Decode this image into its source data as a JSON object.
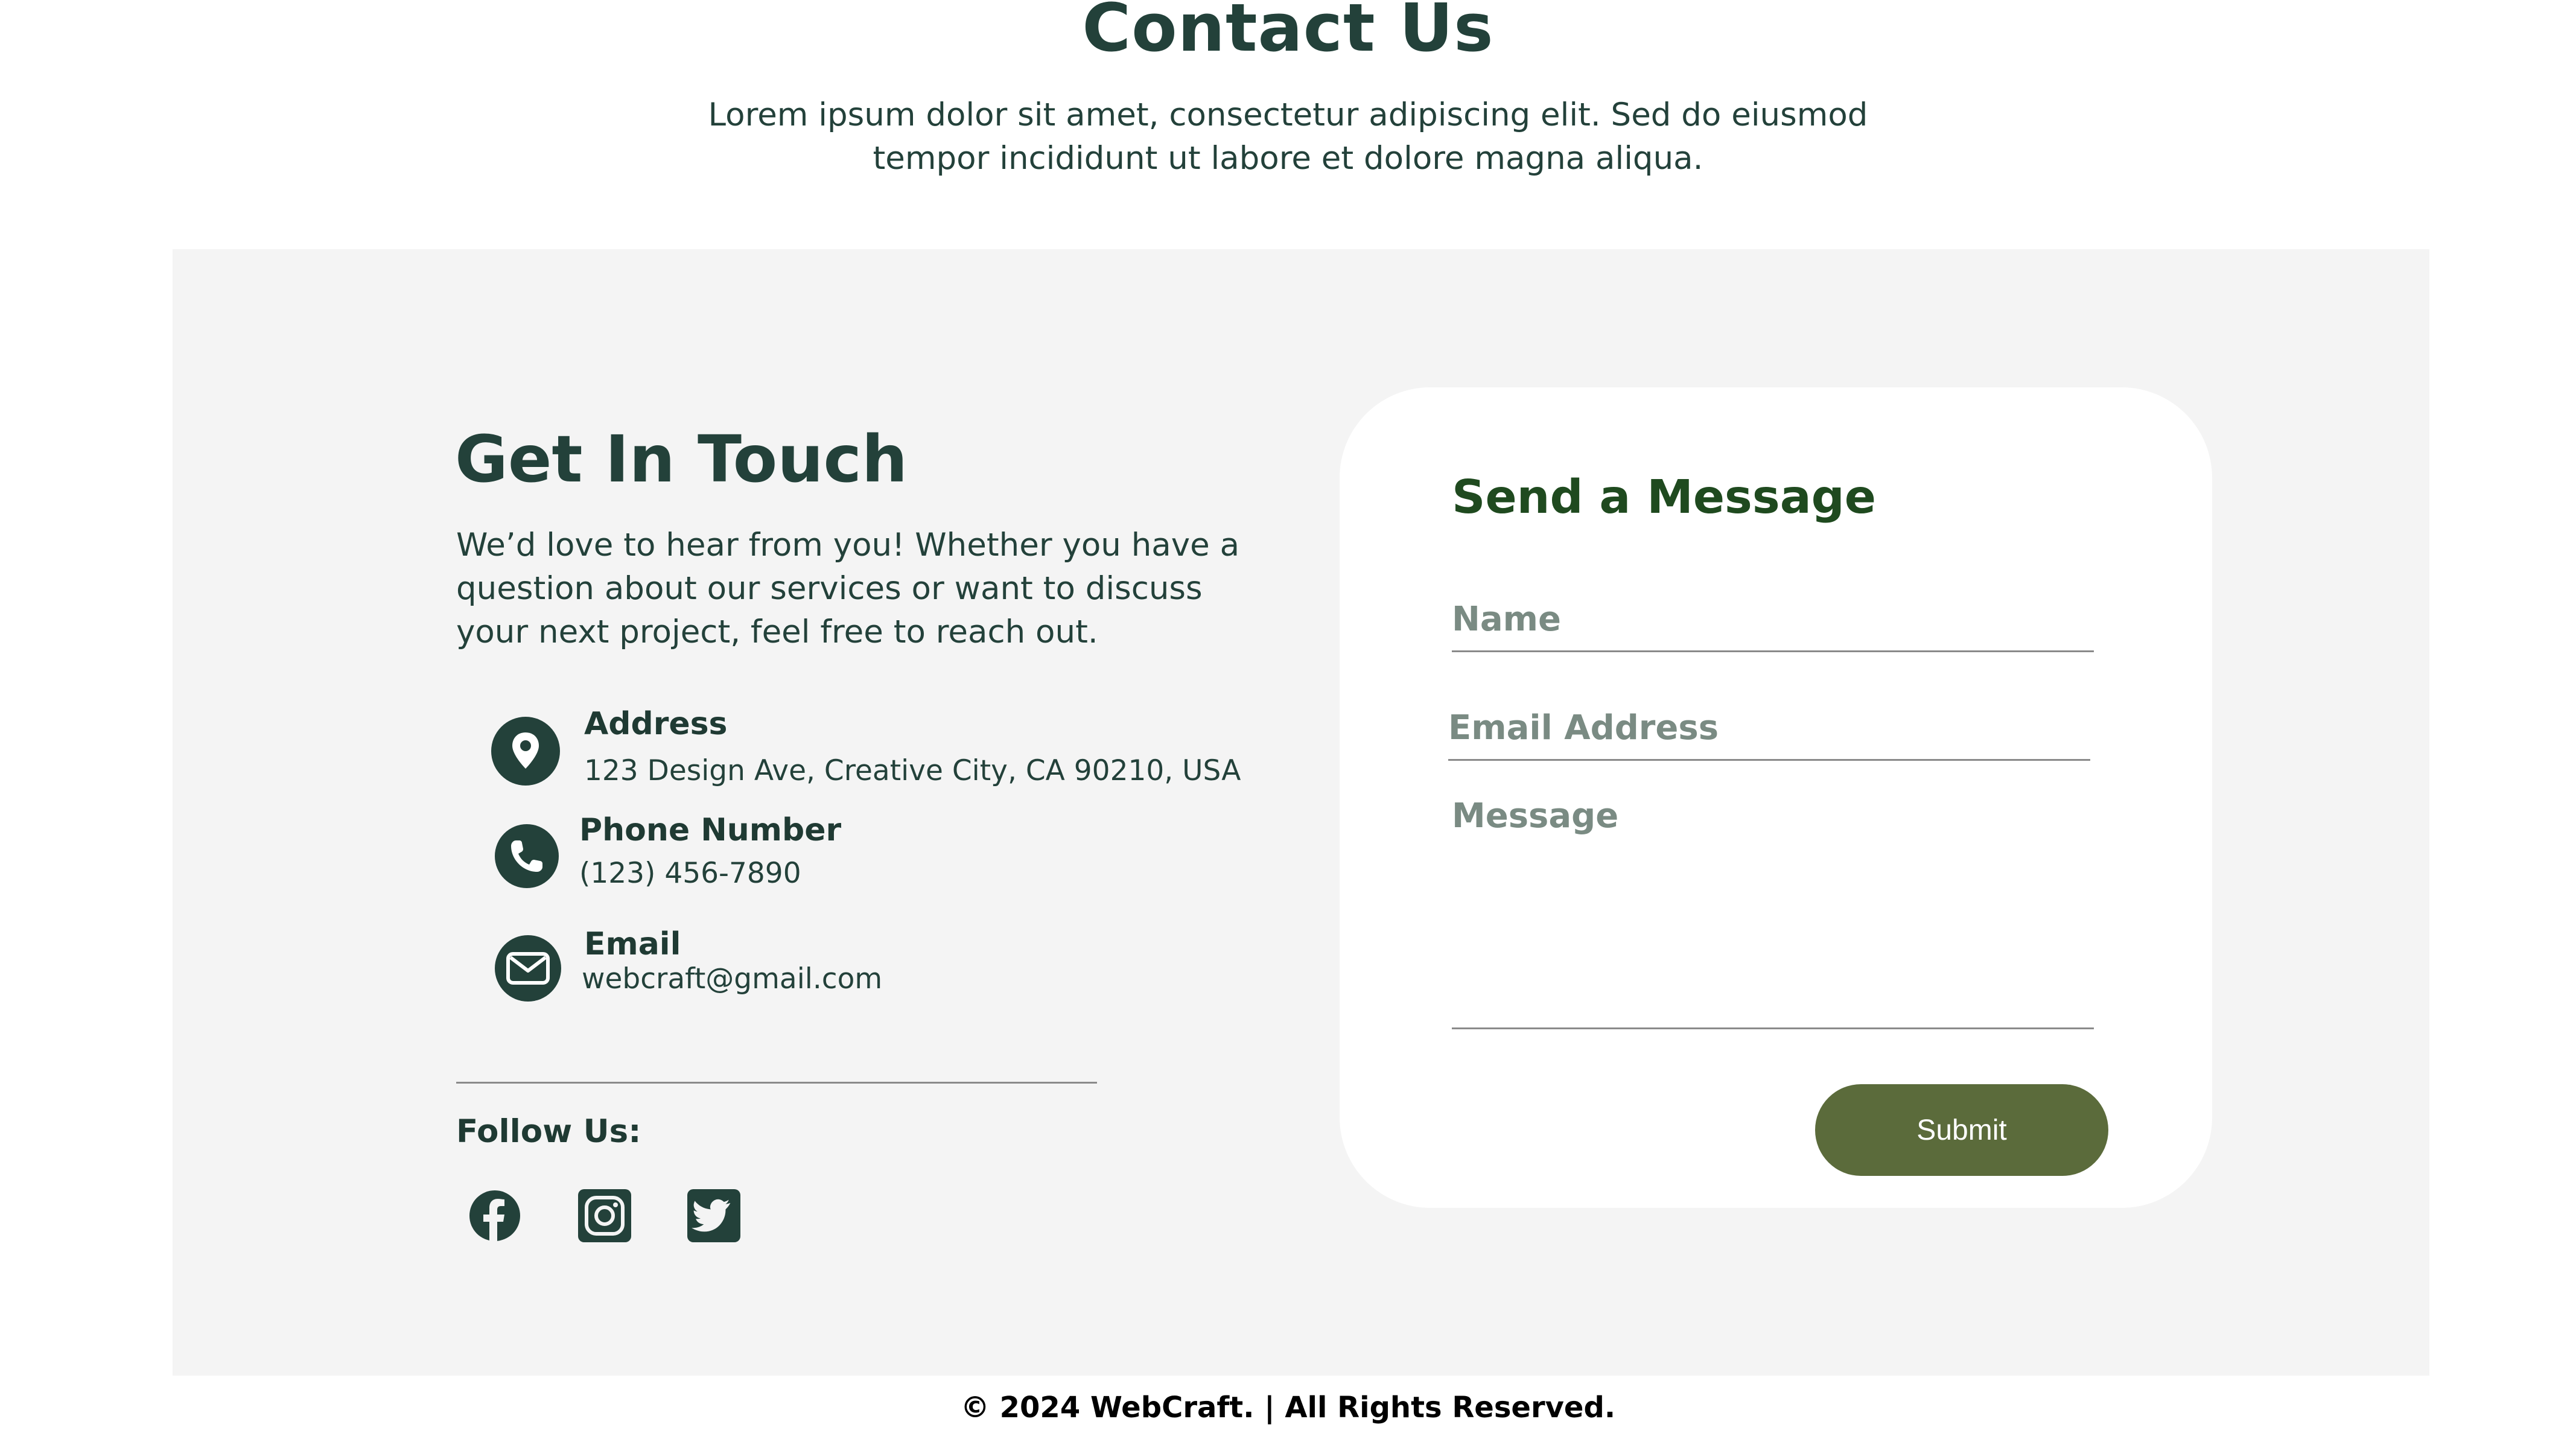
{
  "header": {
    "title": "Contact Us",
    "subtitle_line1": "Lorem ipsum dolor sit amet, consectetur adipiscing elit. Sed do eiusmod",
    "subtitle_line2": "tempor incididunt ut labore et dolore magna aliqua."
  },
  "get_in_touch": {
    "title": "Get In Touch",
    "description_line1": "We’d love to hear from you! Whether you have a",
    "description_line2": "question about our services or want to discuss",
    "description_line3": "your next project, feel free to reach out.",
    "items": [
      {
        "icon": "location-pin-icon",
        "label": "Address",
        "value": "123 Design Ave, Creative City, CA 90210, USA"
      },
      {
        "icon": "phone-icon",
        "label": "Phone Number",
        "value": "(123) 456-7890"
      },
      {
        "icon": "mail-icon",
        "label": "Email",
        "value": "webcraft@gmail.com"
      }
    ],
    "follow_label": "Follow Us:",
    "socials": [
      "facebook-icon",
      "instagram-icon",
      "twitter-icon"
    ]
  },
  "form": {
    "title": "Send a Message",
    "name_placeholder": "Name",
    "email_placeholder": "Email Address",
    "message_placeholder": "Message",
    "submit_label": "Submit"
  },
  "footer": {
    "copyright": "© 2024 WebCraft. | All Rights Reserved."
  },
  "colors": {
    "primary_dark_green": "#23413a",
    "form_title_green": "#1f4a1f",
    "submit_olive": "#5b6b3b",
    "panel_gray": "#f4f4f4"
  }
}
